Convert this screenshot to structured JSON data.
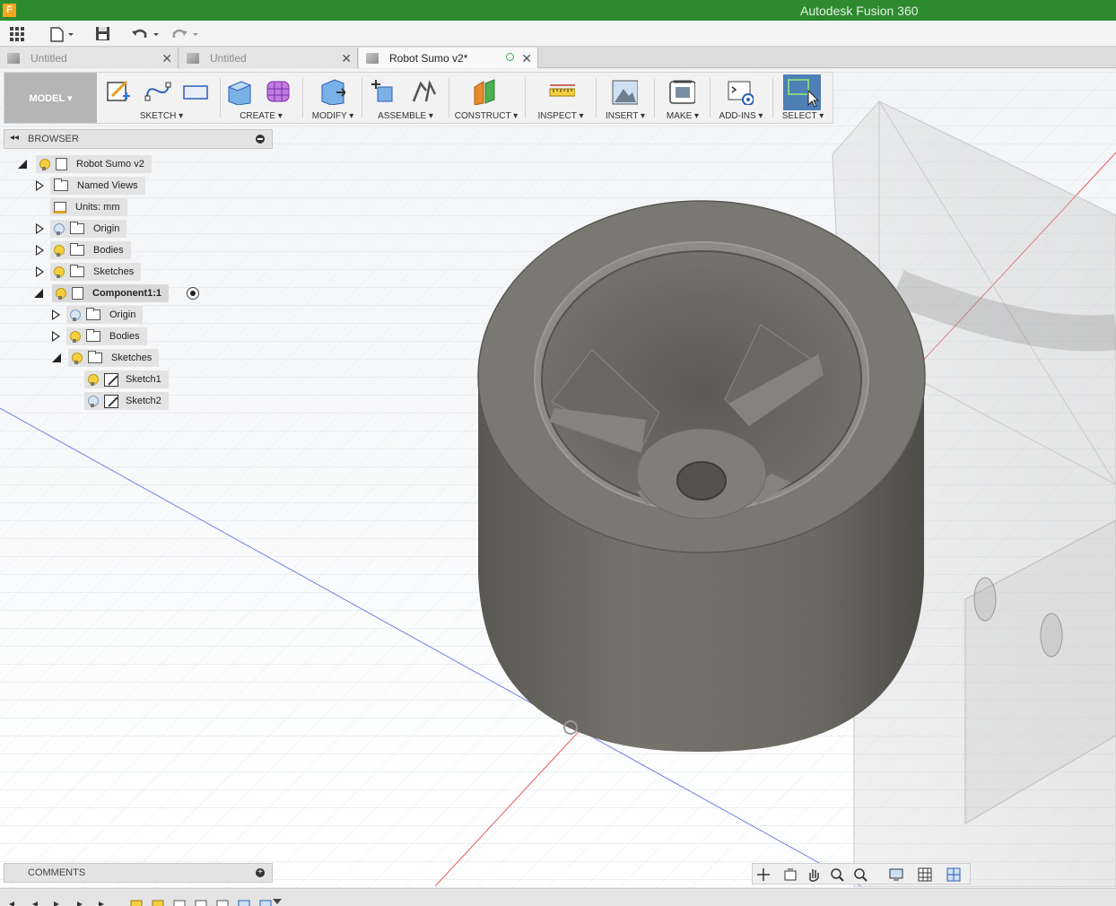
{
  "app": {
    "title": "Autodesk Fusion 360",
    "logo_letter": "F"
  },
  "tabs": [
    {
      "label": "Untitled",
      "active": false
    },
    {
      "label": "Untitled",
      "active": false
    },
    {
      "label": "Robot Sumo v2*",
      "active": true
    }
  ],
  "toolbar": {
    "workspace": "MODEL ▾",
    "groups": {
      "sketch": "SKETCH ▾",
      "create": "CREATE ▾",
      "modify": "MODIFY ▾",
      "assemble": "ASSEMBLE ▾",
      "construct": "CONSTRUCT ▾",
      "inspect": "INSPECT ▾",
      "insert": "INSERT ▾",
      "make": "MAKE ▾",
      "addins": "ADD-INS ▾",
      "select": "SELECT ▾"
    }
  },
  "browser": {
    "header": "BROWSER",
    "root": "Robot Sumo v2",
    "named_views": "Named Views",
    "units": "Units: mm",
    "origin": "Origin",
    "bodies": "Bodies",
    "sketches": "Sketches",
    "component": "Component1:1",
    "comp_origin": "Origin",
    "comp_bodies": "Bodies",
    "comp_sketches": "Sketches",
    "sketch1": "Sketch1",
    "sketch2": "Sketch2"
  },
  "comments": {
    "header": "COMMENTS"
  },
  "colors": {
    "title_bar": "#2d8a2e",
    "select_active": "#4e7fb5",
    "body_gray": "#6f6d66"
  }
}
